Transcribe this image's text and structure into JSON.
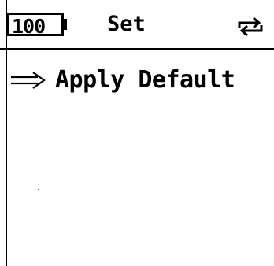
{
  "status_bar": {
    "battery_level": "100",
    "title": "Set",
    "cycle_icon": "cycle-icon"
  },
  "menu": {
    "items": [
      {
        "label": "Apply Default",
        "selected": true,
        "indicator_icon": "right-arrow-icon"
      }
    ]
  },
  "colors": {
    "foreground": "#000000",
    "background": "#ffffff"
  }
}
